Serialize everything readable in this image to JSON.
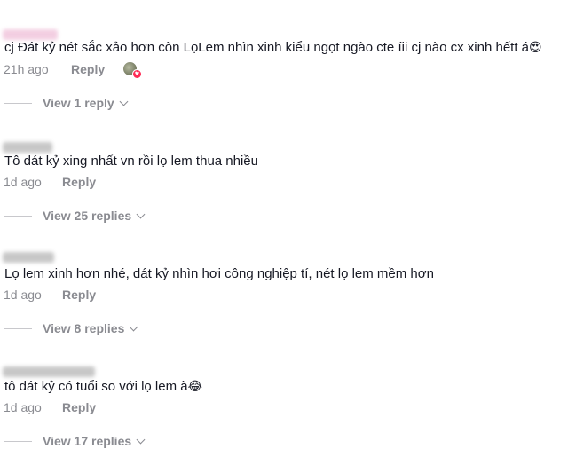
{
  "comments": [
    {
      "text": "cj Đát kỷ nét sắc xảo hơn còn LọLem nhìn xinh kiểu ngọt ngào cte íii cj nào cx xinh hếtt á",
      "emoji": "😍",
      "time": "21h ago",
      "reply_label": "Reply",
      "view_replies_label": "View 1 reply",
      "liked_by_creator": true
    },
    {
      "text": "Tô dát kỷ xing nhất vn rồi lọ lem thua nhiều",
      "emoji": "",
      "time": "1d ago",
      "reply_label": "Reply",
      "view_replies_label": "View 25 replies"
    },
    {
      "text": "Lọ lem xinh hơn nhé, dát kỷ nhìn hơi công nghiệp tí, nét lọ lem mềm hơn",
      "emoji": "",
      "time": "1d ago",
      "reply_label": "Reply",
      "view_replies_label": "View 8 replies"
    },
    {
      "text": "tô dát kỷ có tuổi so với lọ lem à",
      "emoji": "😂",
      "time": "1d ago",
      "reply_label": "Reply",
      "view_replies_label": "View 17 replies"
    }
  ],
  "icons": {
    "expand": "chevron-down-icon",
    "liked": "creator-liked-avatar"
  },
  "colors": {
    "text": "#161823",
    "muted": "#8a8b91",
    "like": "#fe2c55"
  }
}
